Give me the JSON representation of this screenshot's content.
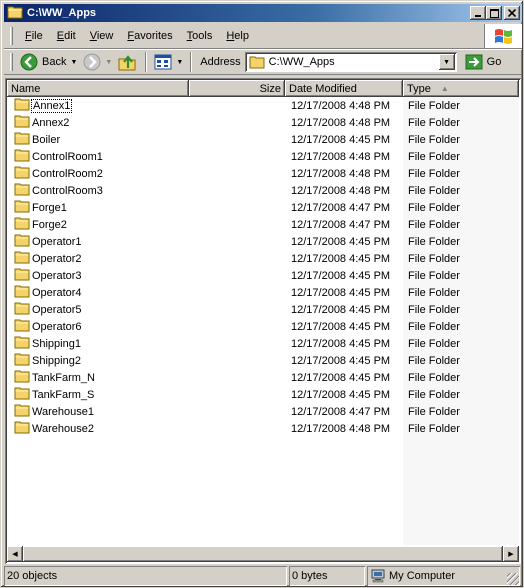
{
  "window": {
    "title": "C:\\WW_Apps"
  },
  "menubar": {
    "items": [
      {
        "u": "F",
        "rest": "ile"
      },
      {
        "u": "E",
        "rest": "dit"
      },
      {
        "u": "V",
        "rest": "iew"
      },
      {
        "u": "F",
        "rest": "avorites"
      },
      {
        "u": "T",
        "rest": "ools"
      },
      {
        "u": "H",
        "rest": "elp"
      }
    ]
  },
  "toolbar": {
    "back_label": "Back",
    "address_label": "Address",
    "address_value": "C:\\WW_Apps",
    "go_label": "Go"
  },
  "columns": {
    "name": "Name",
    "size": "Size",
    "date": "Date Modified",
    "type": "Type"
  },
  "files": [
    {
      "name": "Annex1",
      "date": "12/17/2008 4:48 PM",
      "type": "File Folder"
    },
    {
      "name": "Annex2",
      "date": "12/17/2008 4:48 PM",
      "type": "File Folder"
    },
    {
      "name": "Boiler",
      "date": "12/17/2008 4:45 PM",
      "type": "File Folder"
    },
    {
      "name": "ControlRoom1",
      "date": "12/17/2008 4:48 PM",
      "type": "File Folder"
    },
    {
      "name": "ControlRoom2",
      "date": "12/17/2008 4:48 PM",
      "type": "File Folder"
    },
    {
      "name": "ControlRoom3",
      "date": "12/17/2008 4:48 PM",
      "type": "File Folder"
    },
    {
      "name": "Forge1",
      "date": "12/17/2008 4:47 PM",
      "type": "File Folder"
    },
    {
      "name": "Forge2",
      "date": "12/17/2008 4:47 PM",
      "type": "File Folder"
    },
    {
      "name": "Operator1",
      "date": "12/17/2008 4:45 PM",
      "type": "File Folder"
    },
    {
      "name": "Operator2",
      "date": "12/17/2008 4:45 PM",
      "type": "File Folder"
    },
    {
      "name": "Operator3",
      "date": "12/17/2008 4:45 PM",
      "type": "File Folder"
    },
    {
      "name": "Operator4",
      "date": "12/17/2008 4:45 PM",
      "type": "File Folder"
    },
    {
      "name": "Operator5",
      "date": "12/17/2008 4:45 PM",
      "type": "File Folder"
    },
    {
      "name": "Operator6",
      "date": "12/17/2008 4:45 PM",
      "type": "File Folder"
    },
    {
      "name": "Shipping1",
      "date": "12/17/2008 4:45 PM",
      "type": "File Folder"
    },
    {
      "name": "Shipping2",
      "date": "12/17/2008 4:45 PM",
      "type": "File Folder"
    },
    {
      "name": "TankFarm_N",
      "date": "12/17/2008 4:45 PM",
      "type": "File Folder"
    },
    {
      "name": "TankFarm_S",
      "date": "12/17/2008 4:45 PM",
      "type": "File Folder"
    },
    {
      "name": "Warehouse1",
      "date": "12/17/2008 4:47 PM",
      "type": "File Folder"
    },
    {
      "name": "Warehouse2",
      "date": "12/17/2008 4:48 PM",
      "type": "File Folder"
    }
  ],
  "statusbar": {
    "objects": "20 objects",
    "size": "0 bytes",
    "zone": "My Computer"
  },
  "icons": {
    "folder": "folder-icon",
    "back": "back-arrow-icon",
    "forward": "forward-arrow-icon",
    "up": "up-folder-icon",
    "views": "views-icon",
    "go": "go-arrow-icon",
    "computer": "computer-icon",
    "windows_logo": "windows-logo-icon"
  },
  "colors": {
    "title_start": "#0a246a",
    "title_end": "#a6caf0",
    "face": "#d4d0c8",
    "folder": "#f4d36b"
  }
}
